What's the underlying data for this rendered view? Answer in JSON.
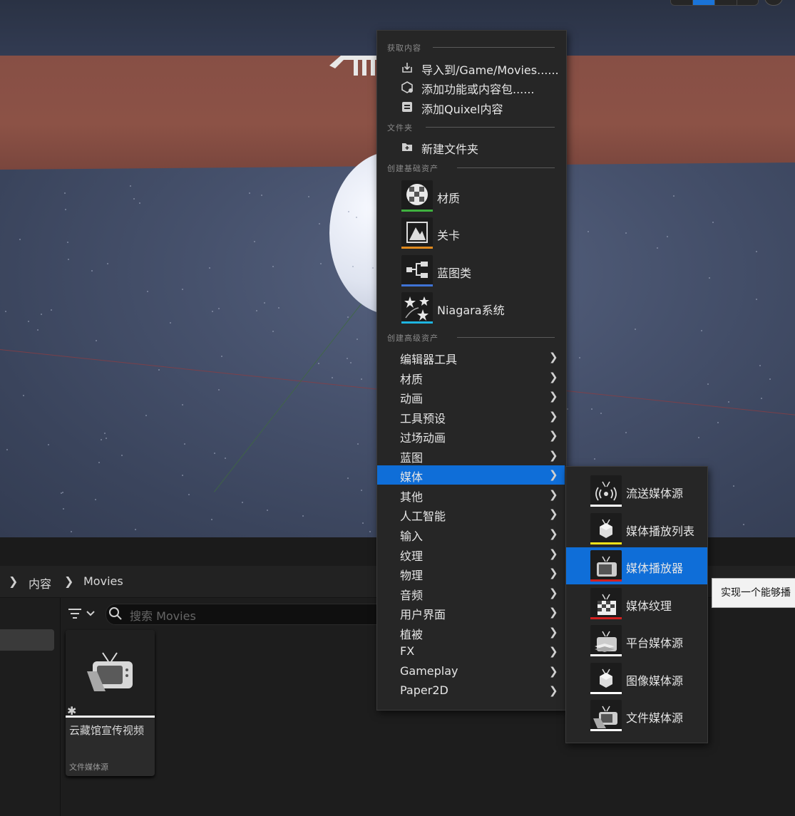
{
  "context_menu": {
    "sections": {
      "get_content": "获取内容",
      "folder": "文件夹",
      "create_basic": "创建基础资产",
      "create_advanced": "创建高级资产"
    },
    "get_content_items": [
      {
        "label": "导入到/Game/Movies......",
        "icon": "import-icon"
      },
      {
        "label": "添加功能或内容包......",
        "icon": "content-pack-icon"
      },
      {
        "label": "添加Quixel内容",
        "icon": "quixel-icon"
      }
    ],
    "folder_items": [
      {
        "label": "新建文件夹",
        "icon": "new-folder-icon"
      }
    ],
    "basic_assets": [
      {
        "label": "材质",
        "icon": "material-icon",
        "color": "#3fb13f"
      },
      {
        "label": "关卡",
        "icon": "level-icon",
        "color": "#e08a1e"
      },
      {
        "label": "蓝图类",
        "icon": "blueprint-icon",
        "color": "#3f73d6"
      },
      {
        "label": "Niagara系统",
        "icon": "niagara-icon",
        "color": "#1eb4e0"
      }
    ],
    "advanced_assets": [
      "编辑器工具",
      "材质",
      "动画",
      "工具预设",
      "过场动画",
      "蓝图",
      "媒体",
      "其他",
      "人工智能",
      "输入",
      "纹理",
      "物理",
      "音频",
      "用户界面",
      "植被",
      "FX",
      "Gameplay",
      "Paper2D"
    ],
    "active_item": "媒体"
  },
  "media_submenu": [
    {
      "label": "流送媒体源",
      "icon": "stream-media-icon",
      "color": "#ffffff"
    },
    {
      "label": "媒体播放列表",
      "icon": "media-playlist-icon",
      "color": "#f2e21a"
    },
    {
      "label": "媒体播放器",
      "icon": "media-player-icon",
      "color": "#d22020"
    },
    {
      "label": "媒体纹理",
      "icon": "media-texture-icon",
      "color": "#d22020"
    },
    {
      "label": "平台媒体源",
      "icon": "platform-media-icon",
      "color": "#ffffff"
    },
    {
      "label": "图像媒体源",
      "icon": "image-media-icon",
      "color": "#ffffff"
    },
    {
      "label": "文件媒体源",
      "icon": "file-media-icon",
      "color": "#ffffff"
    }
  ],
  "tooltip": "实现一个能够播",
  "content_browser": {
    "breadcrumb": [
      "内容",
      "Movies"
    ],
    "search_placeholder": "搜索 Movies",
    "asset": {
      "name": "云藏馆宣传视频",
      "type": "文件媒体源"
    }
  }
}
